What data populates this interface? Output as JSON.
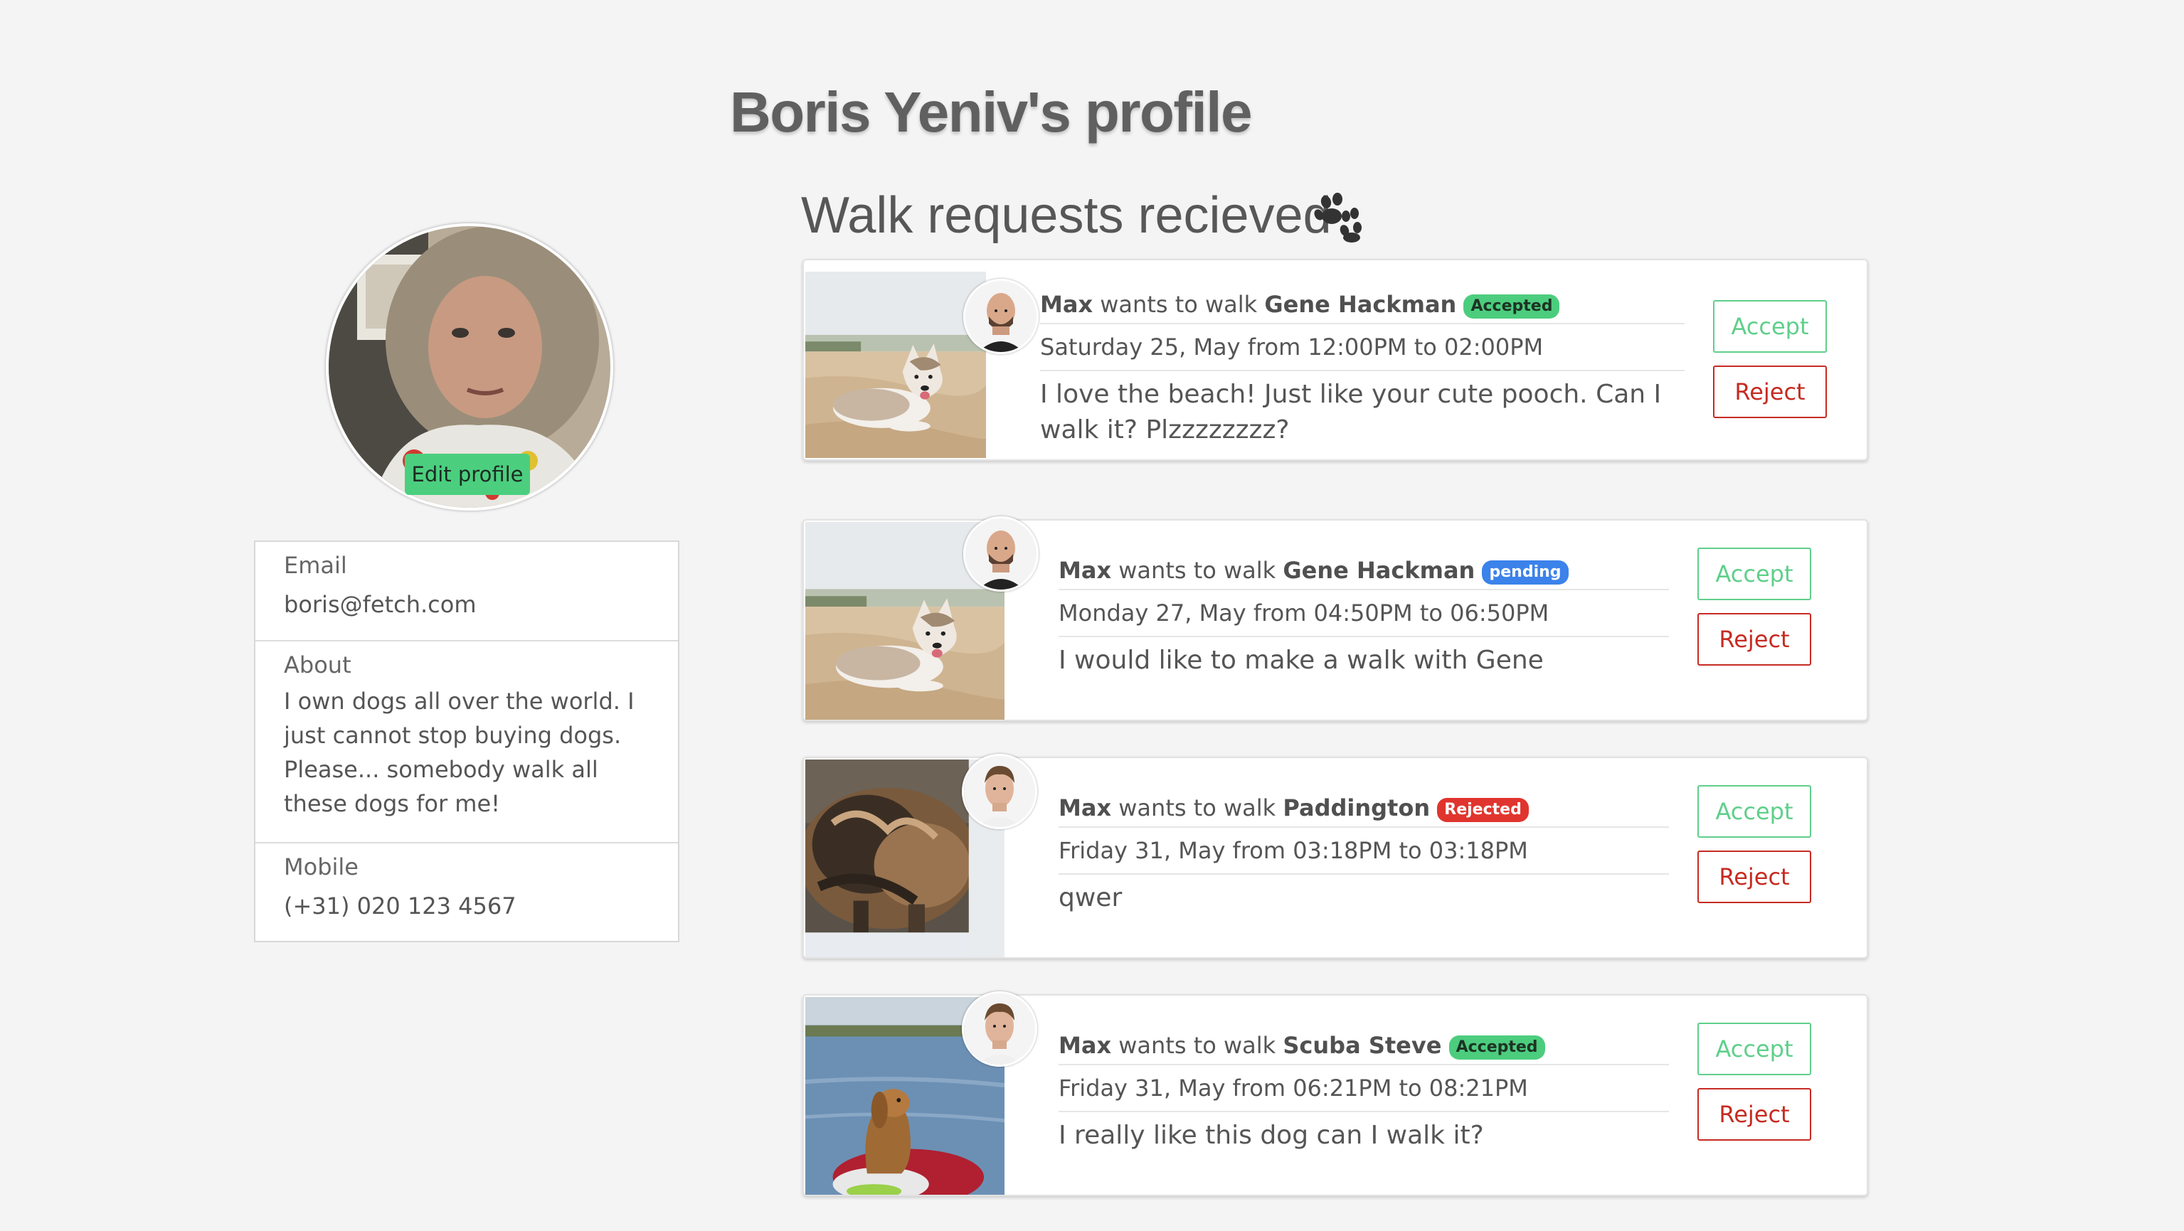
{
  "page": {
    "title": "Boris Yeniv's profile"
  },
  "profile": {
    "edit_label": "Edit profile",
    "email_label": "Email",
    "email": "boris@fetch.com",
    "about_label": "About",
    "about": "I own dogs all over the world. I just cannot stop buying dogs. Please... somebody walk all these dogs for me!",
    "mobile_label": "Mobile",
    "mobile": "(+31) 020 123 4567"
  },
  "requests": {
    "title": "Walk requests recieved",
    "icon": "paw-icon",
    "accept_label": "Accept",
    "reject_label": "Reject",
    "wants_text": "wants to walk",
    "items": [
      {
        "walker": "Max",
        "dog": "Gene Hackman",
        "status": "Accepted",
        "when": "Saturday 25, May from 12:00PM to 02:00PM",
        "message": "I love the beach! Just like your cute pooch. Can I walk it? Plzzzzzzzz?"
      },
      {
        "walker": "Max",
        "dog": "Gene Hackman",
        "status": "pending",
        "when": "Monday 27, May from 04:50PM to 06:50PM",
        "message": "I would like to make a walk with Gene"
      },
      {
        "walker": "Max",
        "dog": "Paddington",
        "status": "Rejected",
        "when": "Friday 31, May from 03:18PM to 03:18PM",
        "message": "qwer"
      },
      {
        "walker": "Max",
        "dog": "Scuba Steve",
        "status": "Accepted",
        "when": "Friday 31, May from 06:21PM to 08:21PM",
        "message": "I really like this dog can I walk it?"
      }
    ]
  },
  "colors": {
    "accept": "#5fcf8b",
    "reject": "#c62b22",
    "accepted_badge": "#4ccd7e",
    "pending_badge": "#3b82ea",
    "rejected_badge": "#e0352e"
  }
}
